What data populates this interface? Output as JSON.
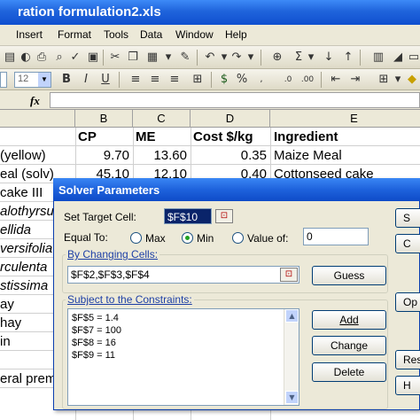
{
  "window": {
    "title": "ration formulation2.xls"
  },
  "menu": [
    "Insert",
    "Format",
    "Tools",
    "Data",
    "Window",
    "Help"
  ],
  "toolbar": {
    "font_size": "12"
  },
  "formula_bar": {
    "fx": "fx",
    "value": ""
  },
  "columns": [
    "B",
    "C",
    "D",
    "E"
  ],
  "header_row": {
    "b": "CP",
    "c": "ME",
    "d": "Cost $/kg",
    "e": "Ingredient"
  },
  "rows": [
    {
      "a": "(yellow)",
      "b": "9.70",
      "c": "13.60",
      "d": "0.35",
      "e": "Maize Meal"
    },
    {
      "a": "eal (solv)",
      "b": "45.10",
      "c": "12.10",
      "d": "0.40",
      "e": "Cottonseed cake"
    },
    {
      "a": "cake III"
    },
    {
      "a": "alothyrsu"
    },
    {
      "a": "ellida"
    },
    {
      "a": "versifolia"
    },
    {
      "a": "rculenta"
    },
    {
      "a": "stissima"
    },
    {
      "a": "ay"
    },
    {
      "a": "hay"
    },
    {
      "a": "in"
    },
    {
      "a": ""
    },
    {
      "a": "eral prem"
    }
  ],
  "solver": {
    "title": "Solver Parameters",
    "set_target_label": "Set Target Cell:",
    "target_value": "$F$10",
    "equal_to_label": "Equal To:",
    "opt_max": "Max",
    "opt_min": "Min",
    "opt_value": "Value of:",
    "value_of": "0",
    "by_changing_label": "By Changing Cells:",
    "changing_cells": "$F$2,$F$3,$F$4",
    "guess_label": "Guess",
    "constraints_label": "Subject to the Constraints:",
    "constraints": [
      "$F$5 = 1.4",
      "$F$7 = 100",
      "$F$8 = 16",
      "$F$9 = 11"
    ],
    "add_label": "Add",
    "change_label": "Change",
    "delete_label": "Delete",
    "side_buttons": [
      "S",
      "C",
      "Op",
      "Res",
      "H"
    ]
  }
}
